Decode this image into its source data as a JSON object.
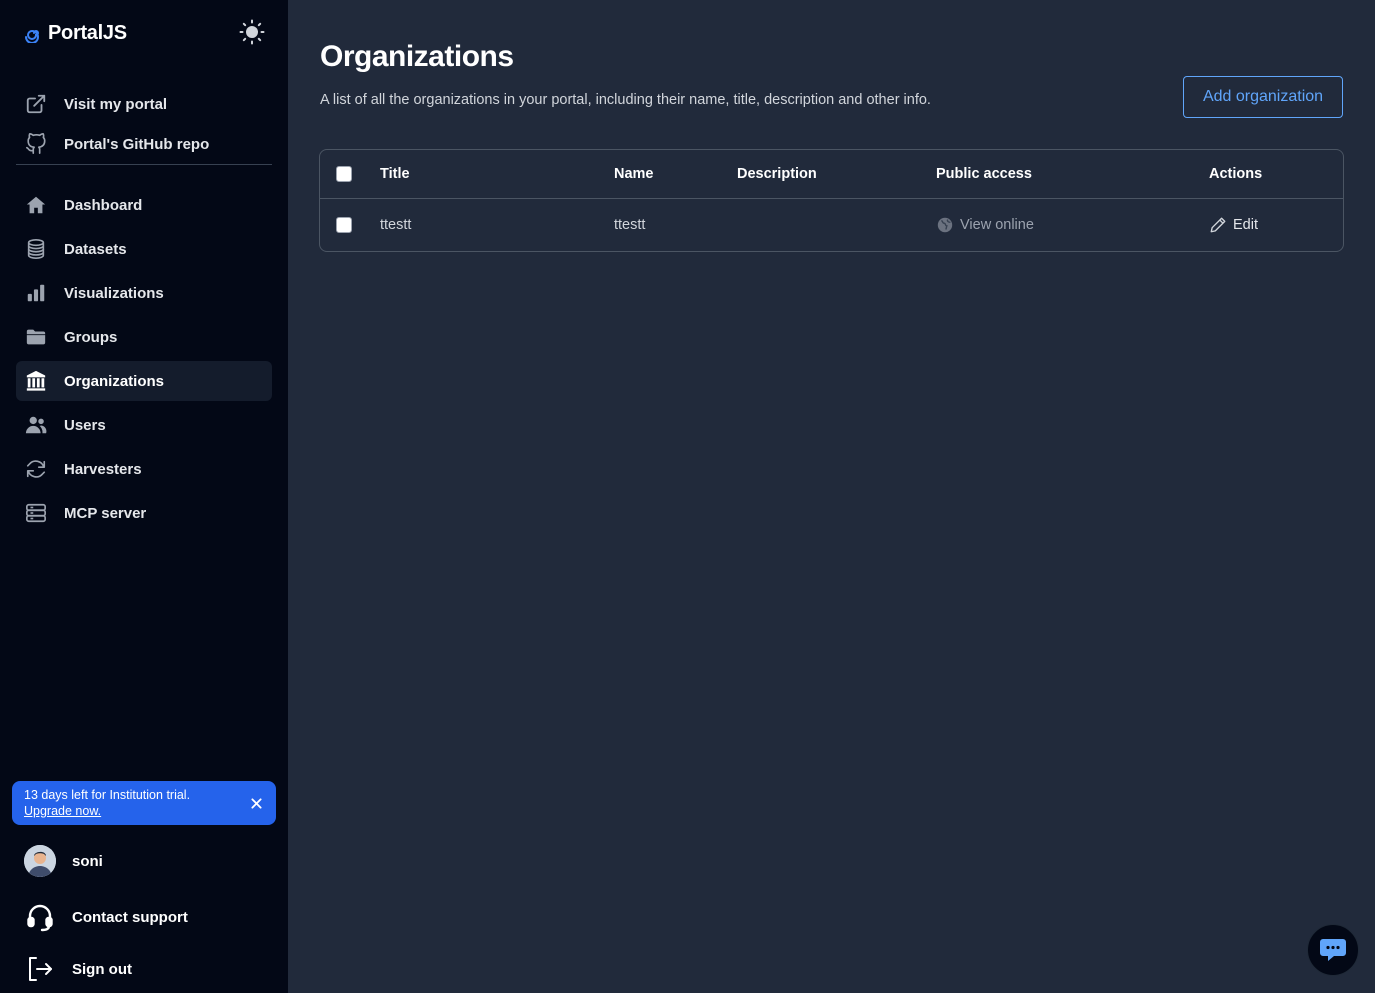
{
  "app": {
    "name": "PortalJS"
  },
  "sidebar": {
    "external_links": [
      {
        "label": "Visit my portal",
        "icon": "external-link-icon"
      },
      {
        "label": "Portal's GitHub repo",
        "icon": "github-icon"
      }
    ],
    "nav": [
      {
        "label": "Dashboard",
        "icon": "home-icon"
      },
      {
        "label": "Datasets",
        "icon": "database-icon"
      },
      {
        "label": "Visualizations",
        "icon": "bar-chart-icon"
      },
      {
        "label": "Groups",
        "icon": "folder-icon"
      },
      {
        "label": "Organizations",
        "icon": "building-icon",
        "active": true
      },
      {
        "label": "Users",
        "icon": "users-icon"
      },
      {
        "label": "Harvesters",
        "icon": "refresh-icon"
      },
      {
        "label": "MCP server",
        "icon": "server-icon"
      }
    ],
    "trial": {
      "text": "13 days left for Institution trial.",
      "link": "Upgrade now."
    },
    "user": {
      "name": "soni"
    },
    "support_label": "Contact support",
    "signout_label": "Sign out"
  },
  "main": {
    "title": "Organizations",
    "subtitle": "A list of all the organizations in your portal, including their name, title, description and other info.",
    "add_button": "Add organization",
    "table": {
      "headers": {
        "title": "Title",
        "name": "Name",
        "description": "Description",
        "public_access": "Public access",
        "actions": "Actions"
      },
      "rows": [
        {
          "title": "ttestt",
          "name": "ttestt",
          "description": "",
          "public_access": "View online",
          "action": "Edit"
        }
      ]
    }
  },
  "colors": {
    "sidebar_bg": "#030816",
    "main_bg": "#212a3b",
    "accent": "#2563eb",
    "link": "#60a5fa"
  }
}
